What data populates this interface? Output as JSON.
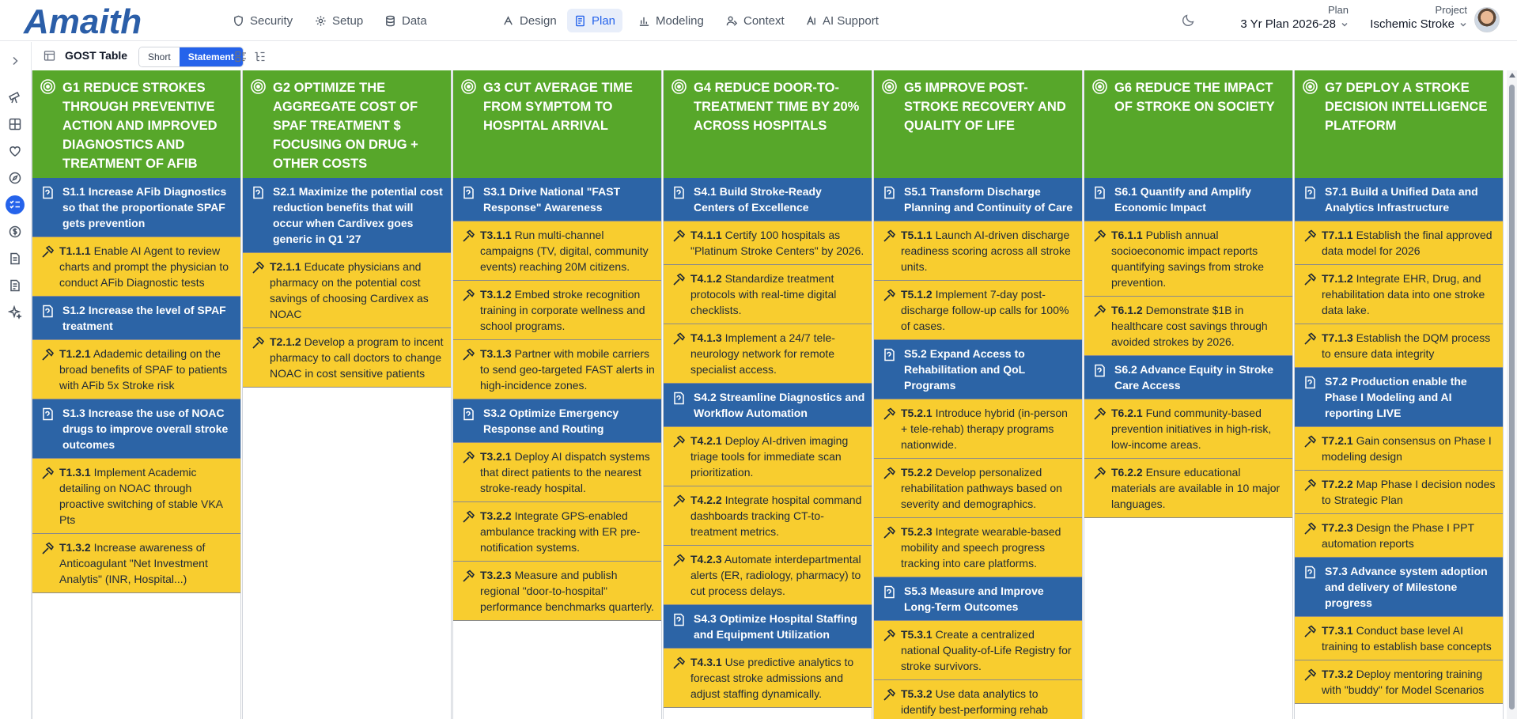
{
  "app": {
    "logo_text": "Amaith"
  },
  "nav": [
    {
      "label": "Security",
      "icon": "shield-icon"
    },
    {
      "label": "Setup",
      "icon": "gear-icon"
    },
    {
      "label": "Data",
      "icon": "database-icon"
    },
    {
      "label": "Design",
      "icon": "design-icon"
    },
    {
      "label": "Plan",
      "icon": "document-icon",
      "active": true
    },
    {
      "label": "Modeling",
      "icon": "bar-chart-icon"
    },
    {
      "label": "Context",
      "icon": "context-icon"
    },
    {
      "label": "AI Support",
      "icon": "ai-icon"
    }
  ],
  "plan": {
    "label": "Plan",
    "value": "3 Yr Plan 2026-28"
  },
  "project": {
    "label": "Project",
    "value": "Ischemic Stroke"
  },
  "subbar": {
    "title": "GOST Table",
    "short": "Short",
    "statement": "Statement",
    "active": "Statement"
  },
  "colors": {
    "goal": "#57a72a",
    "strategy": "#2c64a6",
    "tactic": "#f8cd2f",
    "accent": "#2563eb"
  },
  "goals": [
    {
      "code": "G1",
      "title": "Reduce Strokes Through Preventive Action and Improved Diagnostics and Treatment of AFib",
      "items": [
        {
          "type": "strategy",
          "code": "S1.1",
          "text": "Increase AFib Diagnostics so that the proportionate SPAF gets prevention"
        },
        {
          "type": "tactic",
          "code": "T1.1.1",
          "text": "Enable AI Agent to review charts and prompt the physician to conduct AFib Diagnostic tests"
        },
        {
          "type": "strategy",
          "code": "S1.2",
          "text": "Increase the level of SPAF treatment"
        },
        {
          "type": "tactic",
          "code": "T1.2.1",
          "text": "Adademic detailing on the broad benefits of SPAF to patients with AFib 5x Stroke risk"
        },
        {
          "type": "strategy",
          "code": "S1.3",
          "text": "Increase the use of NOAC drugs to improve overall stroke outcomes"
        },
        {
          "type": "tactic",
          "code": "T1.3.1",
          "text": "Implement Academic detailing on NOAC through proactive switching of stable VKA Pts"
        },
        {
          "type": "tactic",
          "code": "T1.3.2",
          "text": "Increase awareness of Anticoagulant \"Net Investment Analytis\" (INR, Hospital...)"
        }
      ]
    },
    {
      "code": "G2",
      "title": "Optimize the aggregate cost of SPAF treatment $ focusing on drug + other costs",
      "items": [
        {
          "type": "strategy",
          "code": "S2.1",
          "text": "Maximize the potential cost reduction benefits that will occur when Cardivex goes generic in Q1 '27"
        },
        {
          "type": "tactic",
          "code": "T2.1.1",
          "text": "Educate physicians and pharmacy on the potential cost savings of choosing Cardivex as NOAC"
        },
        {
          "type": "tactic",
          "code": "T2.1.2",
          "text": "Develop a program to incent pharmacy to call doctors to change NOAC in cost sensitive patients"
        }
      ]
    },
    {
      "code": "G3",
      "title": "Cut Average Time from Symptom to Hospital Arrival",
      "items": [
        {
          "type": "strategy",
          "code": "S3.1",
          "text": "Drive National \"FAST Response\" Awareness"
        },
        {
          "type": "tactic",
          "code": "T3.1.1",
          "text": "Run multi-channel campaigns (TV, digital, community events) reaching 20M citizens."
        },
        {
          "type": "tactic",
          "code": "T3.1.2",
          "text": "Embed stroke recognition training in corporate wellness and school programs."
        },
        {
          "type": "tactic",
          "code": "T3.1.3",
          "text": "Partner with mobile carriers to send geo-targeted FAST alerts in high-incidence zones."
        },
        {
          "type": "strategy",
          "code": "S3.2",
          "text": "Optimize Emergency Response and Routing"
        },
        {
          "type": "tactic",
          "code": "T3.2.1",
          "text": "Deploy AI dispatch systems that direct patients to the nearest stroke-ready hospital."
        },
        {
          "type": "tactic",
          "code": "T3.2.2",
          "text": "Integrate GPS-enabled ambulance tracking with ER pre-notification systems."
        },
        {
          "type": "tactic",
          "code": "T3.2.3",
          "text": "Measure and publish regional \"door-to-hospital\" performance benchmarks quarterly."
        }
      ]
    },
    {
      "code": "G4",
      "title": "Reduce Door-to-Treatment Time by 20% Across Hospitals",
      "items": [
        {
          "type": "strategy",
          "code": "S4.1",
          "text": "Build Stroke-Ready Centers of Excellence"
        },
        {
          "type": "tactic",
          "code": "T4.1.1",
          "text": "Certify 100 hospitals as \"Platinum Stroke Centers\" by 2026."
        },
        {
          "type": "tactic",
          "code": "T4.1.2",
          "text": "Standardize treatment protocols with real-time digital checklists."
        },
        {
          "type": "tactic",
          "code": "T4.1.3",
          "text": "Implement a 24/7 tele-neurology network for remote specialist access."
        },
        {
          "type": "strategy",
          "code": "S4.2",
          "text": "Streamline Diagnostics and Workflow Automation"
        },
        {
          "type": "tactic",
          "code": "T4.2.1",
          "text": "Deploy AI-driven imaging triage tools for immediate scan prioritization."
        },
        {
          "type": "tactic",
          "code": "T4.2.2",
          "text": "Integrate hospital command dashboards tracking CT-to-treatment metrics."
        },
        {
          "type": "tactic",
          "code": "T4.2.3",
          "text": "Automate interdepartmental alerts (ER, radiology, pharmacy) to cut process delays."
        },
        {
          "type": "strategy",
          "code": "S4.3",
          "text": "Optimize Hospital Staffing and Equipment Utilization"
        },
        {
          "type": "tactic",
          "code": "T4.3.1",
          "text": "Use predictive analytics to forecast stroke admissions and adjust staffing dynamically."
        }
      ]
    },
    {
      "code": "G5",
      "title": "Improve Post-Stroke Recovery and Quality of Life",
      "items": [
        {
          "type": "strategy",
          "code": "S5.1",
          "text": "Transform Discharge Planning and Continuity of Care"
        },
        {
          "type": "tactic",
          "code": "T5.1.1",
          "text": "Launch AI-driven discharge readiness scoring across all stroke units."
        },
        {
          "type": "tactic",
          "code": "T5.1.2",
          "text": "Implement 7-day post-discharge follow-up calls for 100% of cases."
        },
        {
          "type": "strategy",
          "code": "S5.2",
          "text": "Expand Access to Rehabilitation and QoL Programs"
        },
        {
          "type": "tactic",
          "code": "T5.2.1",
          "text": "Introduce hybrid (in-person + tele-rehab) therapy programs nationwide."
        },
        {
          "type": "tactic",
          "code": "T5.2.2",
          "text": "Develop personalized rehabilitation pathways based on severity and demographics."
        },
        {
          "type": "tactic",
          "code": "T5.2.3",
          "text": "Integrate wearable-based mobility and speech progress tracking into care platforms."
        },
        {
          "type": "strategy",
          "code": "S5.3",
          "text": "Measure and Improve Long-Term Outcomes"
        },
        {
          "type": "tactic",
          "code": "T5.3.1",
          "text": "Create a centralized national Quality-of-Life Registry for stroke survivors."
        },
        {
          "type": "tactic",
          "code": "T5.3.2",
          "text": "Use data analytics to identify best-performing rehab programs and scale them."
        }
      ]
    },
    {
      "code": "G6",
      "title": "Reduce the Impact of Stroke on Society",
      "items": [
        {
          "type": "strategy",
          "code": "S6.1",
          "text": "Quantify and Amplify Economic Impact"
        },
        {
          "type": "tactic",
          "code": "T6.1.1",
          "text": "Publish annual socioeconomic impact reports quantifying savings from stroke prevention."
        },
        {
          "type": "tactic",
          "code": "T6.1.2",
          "text": "Demonstrate $1B in healthcare cost savings through avoided strokes by 2026."
        },
        {
          "type": "strategy",
          "code": "S6.2",
          "text": "Advance Equity in Stroke Care Access"
        },
        {
          "type": "tactic",
          "code": "T6.2.1",
          "text": "Fund community-based prevention initiatives in high-risk, low-income areas."
        },
        {
          "type": "tactic",
          "code": "T6.2.2",
          "text": "Ensure educational materials are available in 10 major languages."
        }
      ]
    },
    {
      "code": "G7",
      "title": "Deploy a Stroke Decision Intelligence Platform",
      "items": [
        {
          "type": "strategy",
          "code": "S7.1",
          "text": "Build a Unified Data and Analytics Infrastructure"
        },
        {
          "type": "tactic",
          "code": "T7.1.1",
          "text": "Establish the final approved data model for 2026"
        },
        {
          "type": "tactic",
          "code": "T7.1.2",
          "text": "Integrate EHR, Drug, and rehabilitation data into one stroke data lake."
        },
        {
          "type": "tactic",
          "code": "T7.1.3",
          "text": "Establish the DQM process to ensure data integrity"
        },
        {
          "type": "strategy",
          "code": "S7.2",
          "text": "Production enable the Phase I Modeling and AI reporting LIVE"
        },
        {
          "type": "tactic",
          "code": "T7.2.1",
          "text": "Gain consensus on Phase I modeling design"
        },
        {
          "type": "tactic",
          "code": "T7.2.2",
          "text": "Map Phase I decision nodes to Strategic Plan"
        },
        {
          "type": "tactic",
          "code": "T7.2.3",
          "text": "Design the Phase I PPT automation reports"
        },
        {
          "type": "strategy",
          "code": "S7.3",
          "text": "Advance system adoption and delivery of Milestone progress"
        },
        {
          "type": "tactic",
          "code": "T7.3.1",
          "text": "Conduct base level AI training to establish base concepts"
        },
        {
          "type": "tactic",
          "code": "T7.3.2",
          "text": "Deploy mentoring training with \"buddy\" for Model Scenarios"
        }
      ]
    }
  ]
}
